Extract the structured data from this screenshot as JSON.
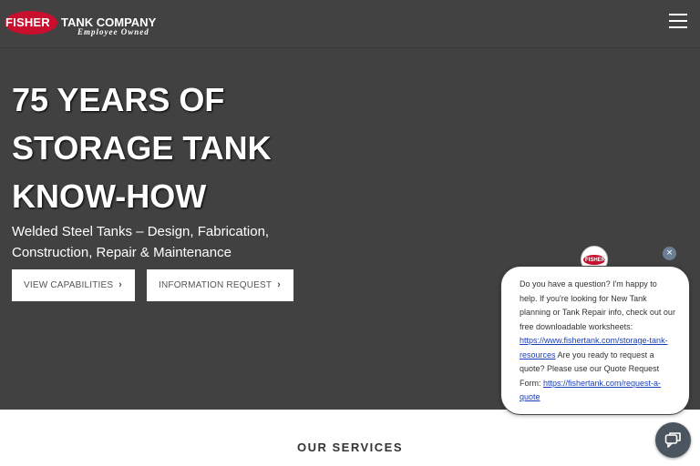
{
  "header": {
    "logo_primary": "FISHER",
    "logo_secondary": "TANK COMPANY",
    "logo_tagline": "Employee Owned",
    "menu_icon": "hamburger-menu-icon"
  },
  "hero": {
    "title_line1": "75 YEARS OF",
    "title_line2": "STORAGE TANK",
    "title_line3": "KNOW-HOW",
    "subtitle_line1": "Welded Steel Tanks – Design, Fabrication,",
    "subtitle_line2": "Construction, Repair & Maintenance",
    "buttons": [
      {
        "label": "VIEW CAPABILITIES",
        "icon": "chevron-right-icon"
      },
      {
        "label": "INFORMATION REQUEST",
        "icon": "chevron-right-icon"
      }
    ]
  },
  "services": {
    "heading": "OUR SERVICES"
  },
  "chat": {
    "avatar_text": "FISHER",
    "close_glyph": "×",
    "message_part1": "Do you have a question? I'm happy to help. If you're looking for New Tank planning or Tank Repair info, check out our free downloadable worksheets: ",
    "link1": "https://www.fishertank.com/storage-tank-resources",
    "message_part2": " Are you ready to request a quote? Please use our Quote Request Form: ",
    "link2": "https://fishertank.com/request-a-quote",
    "launcher_icon": "chat-bubbles-icon"
  },
  "colors": {
    "header_bg": "#424242",
    "hero_bg": "#414141",
    "brand_red": "#c8102e",
    "link": "#1a3fb8",
    "chat_launcher": "#4a5560"
  }
}
